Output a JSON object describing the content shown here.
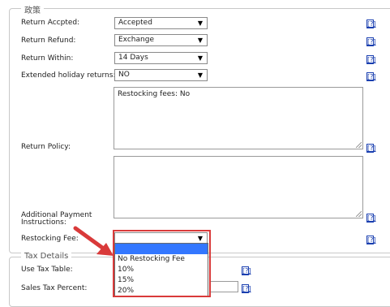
{
  "policy_section": {
    "legend": "政策",
    "fields": {
      "return_accepted": {
        "label": "Return Accpted:",
        "value": "Accepted"
      },
      "return_refund": {
        "label": "Return Refund:",
        "value": "Exchange"
      },
      "return_within": {
        "label": "Return Within:",
        "value": "14 Days"
      },
      "extended_holiday": {
        "label": "Extended holiday returns:",
        "value": "NO"
      },
      "return_policy": {
        "label": "Return Policy:",
        "value": "Restocking fees: No"
      },
      "additional_payment": {
        "label": "Additional Payment Instructions:",
        "value": ""
      },
      "restocking_fee": {
        "label": "Restocking Fee:",
        "value": ""
      }
    },
    "help_text": "[?]"
  },
  "restocking_dropdown": {
    "options": [
      "",
      "No Restocking Fee",
      "10%",
      "15%",
      "20%"
    ],
    "selected_index": 0
  },
  "tax_section": {
    "legend": "Tax Details",
    "use_tax_table_label": "Use Tax Table:",
    "sales_tax_percent_label": "Sales Tax Percent:"
  },
  "colors": {
    "highlight": "#d93a3a",
    "arrow": "#d93a3a",
    "selected_option": "#3377ff",
    "help_link": "#1a3fb0"
  },
  "icons": {
    "dropdown": "triangle-down-icon",
    "callout": "red-arrow-icon"
  }
}
